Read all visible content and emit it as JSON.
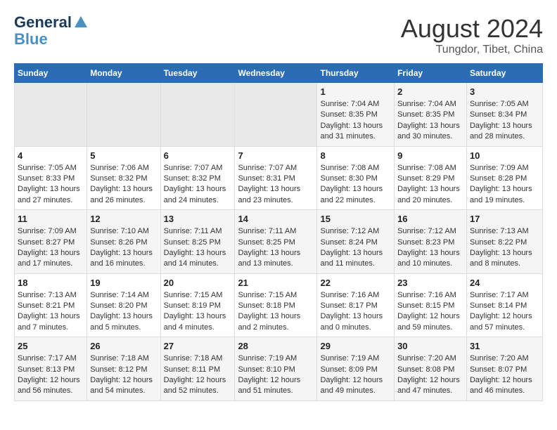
{
  "logo": {
    "line1": "General",
    "line2": "Blue"
  },
  "title": "August 2024",
  "subtitle": "Tungdor, Tibet, China",
  "days_of_week": [
    "Sunday",
    "Monday",
    "Tuesday",
    "Wednesday",
    "Thursday",
    "Friday",
    "Saturday"
  ],
  "weeks": [
    [
      {
        "day": "",
        "empty": true
      },
      {
        "day": "",
        "empty": true
      },
      {
        "day": "",
        "empty": true
      },
      {
        "day": "",
        "empty": true
      },
      {
        "day": "1",
        "sunrise": "7:04 AM",
        "sunset": "8:35 PM",
        "daylight": "13 hours and 31 minutes."
      },
      {
        "day": "2",
        "sunrise": "7:04 AM",
        "sunset": "8:35 PM",
        "daylight": "13 hours and 30 minutes."
      },
      {
        "day": "3",
        "sunrise": "7:05 AM",
        "sunset": "8:34 PM",
        "daylight": "13 hours and 28 minutes."
      }
    ],
    [
      {
        "day": "4",
        "sunrise": "7:05 AM",
        "sunset": "8:33 PM",
        "daylight": "13 hours and 27 minutes."
      },
      {
        "day": "5",
        "sunrise": "7:06 AM",
        "sunset": "8:32 PM",
        "daylight": "13 hours and 26 minutes."
      },
      {
        "day": "6",
        "sunrise": "7:07 AM",
        "sunset": "8:32 PM",
        "daylight": "13 hours and 24 minutes."
      },
      {
        "day": "7",
        "sunrise": "7:07 AM",
        "sunset": "8:31 PM",
        "daylight": "13 hours and 23 minutes."
      },
      {
        "day": "8",
        "sunrise": "7:08 AM",
        "sunset": "8:30 PM",
        "daylight": "13 hours and 22 minutes."
      },
      {
        "day": "9",
        "sunrise": "7:08 AM",
        "sunset": "8:29 PM",
        "daylight": "13 hours and 20 minutes."
      },
      {
        "day": "10",
        "sunrise": "7:09 AM",
        "sunset": "8:28 PM",
        "daylight": "13 hours and 19 minutes."
      }
    ],
    [
      {
        "day": "11",
        "sunrise": "7:09 AM",
        "sunset": "8:27 PM",
        "daylight": "13 hours and 17 minutes."
      },
      {
        "day": "12",
        "sunrise": "7:10 AM",
        "sunset": "8:26 PM",
        "daylight": "13 hours and 16 minutes."
      },
      {
        "day": "13",
        "sunrise": "7:11 AM",
        "sunset": "8:25 PM",
        "daylight": "13 hours and 14 minutes."
      },
      {
        "day": "14",
        "sunrise": "7:11 AM",
        "sunset": "8:25 PM",
        "daylight": "13 hours and 13 minutes."
      },
      {
        "day": "15",
        "sunrise": "7:12 AM",
        "sunset": "8:24 PM",
        "daylight": "13 hours and 11 minutes."
      },
      {
        "day": "16",
        "sunrise": "7:12 AM",
        "sunset": "8:23 PM",
        "daylight": "13 hours and 10 minutes."
      },
      {
        "day": "17",
        "sunrise": "7:13 AM",
        "sunset": "8:22 PM",
        "daylight": "13 hours and 8 minutes."
      }
    ],
    [
      {
        "day": "18",
        "sunrise": "7:13 AM",
        "sunset": "8:21 PM",
        "daylight": "13 hours and 7 minutes."
      },
      {
        "day": "19",
        "sunrise": "7:14 AM",
        "sunset": "8:20 PM",
        "daylight": "13 hours and 5 minutes."
      },
      {
        "day": "20",
        "sunrise": "7:15 AM",
        "sunset": "8:19 PM",
        "daylight": "13 hours and 4 minutes."
      },
      {
        "day": "21",
        "sunrise": "7:15 AM",
        "sunset": "8:18 PM",
        "daylight": "13 hours and 2 minutes."
      },
      {
        "day": "22",
        "sunrise": "7:16 AM",
        "sunset": "8:17 PM",
        "daylight": "13 hours and 0 minutes."
      },
      {
        "day": "23",
        "sunrise": "7:16 AM",
        "sunset": "8:15 PM",
        "daylight": "12 hours and 59 minutes."
      },
      {
        "day": "24",
        "sunrise": "7:17 AM",
        "sunset": "8:14 PM",
        "daylight": "12 hours and 57 minutes."
      }
    ],
    [
      {
        "day": "25",
        "sunrise": "7:17 AM",
        "sunset": "8:13 PM",
        "daylight": "12 hours and 56 minutes."
      },
      {
        "day": "26",
        "sunrise": "7:18 AM",
        "sunset": "8:12 PM",
        "daylight": "12 hours and 54 minutes."
      },
      {
        "day": "27",
        "sunrise": "7:18 AM",
        "sunset": "8:11 PM",
        "daylight": "12 hours and 52 minutes."
      },
      {
        "day": "28",
        "sunrise": "7:19 AM",
        "sunset": "8:10 PM",
        "daylight": "12 hours and 51 minutes."
      },
      {
        "day": "29",
        "sunrise": "7:19 AM",
        "sunset": "8:09 PM",
        "daylight": "12 hours and 49 minutes."
      },
      {
        "day": "30",
        "sunrise": "7:20 AM",
        "sunset": "8:08 PM",
        "daylight": "12 hours and 47 minutes."
      },
      {
        "day": "31",
        "sunrise": "7:20 AM",
        "sunset": "8:07 PM",
        "daylight": "12 hours and 46 minutes."
      }
    ]
  ],
  "labels": {
    "sunrise": "Sunrise:",
    "sunset": "Sunset:",
    "daylight": "Daylight:"
  }
}
